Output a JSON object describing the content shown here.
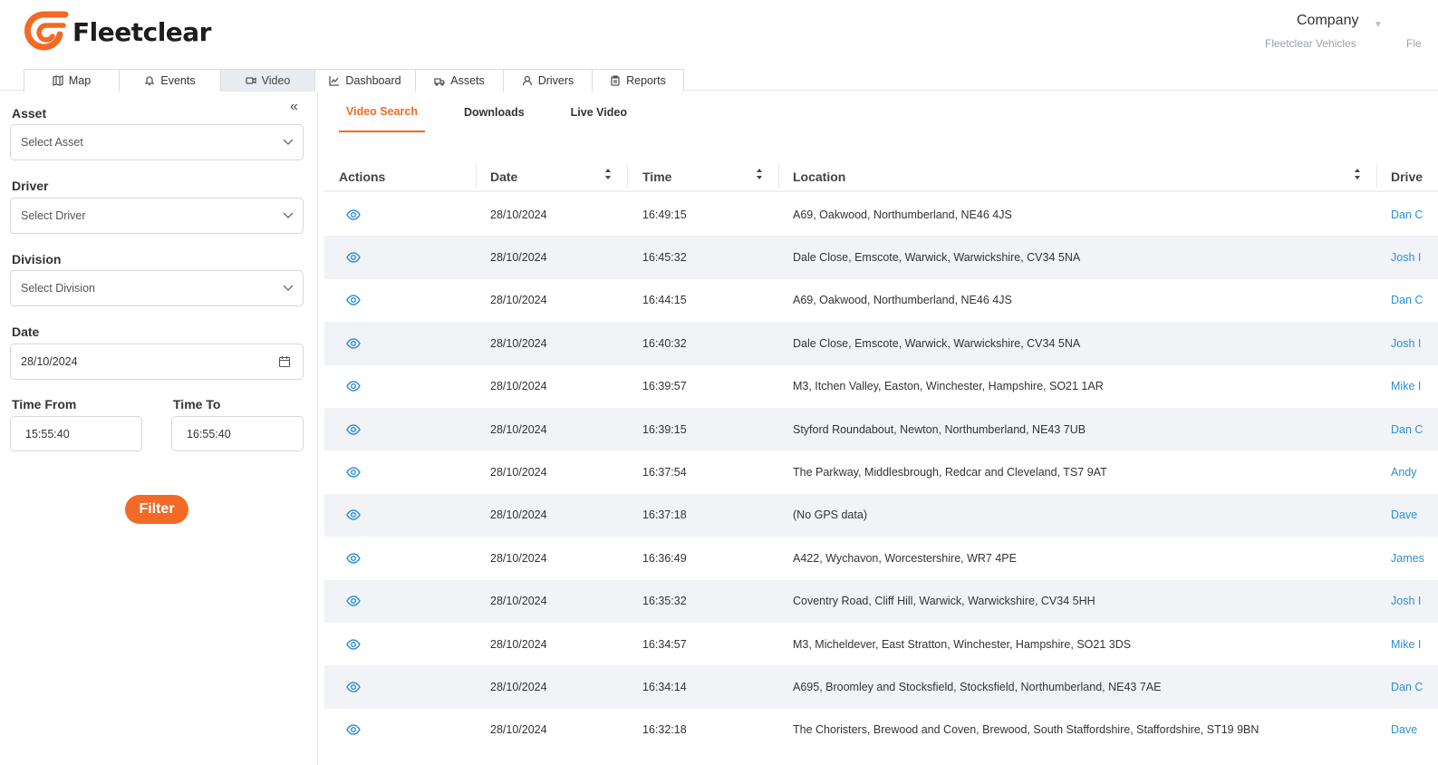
{
  "brand": {
    "name": "Fleetclear",
    "accent": "#f26a25",
    "link": "#2b8fd6"
  },
  "company": {
    "title": "Company",
    "subtitle": "Fleetclear Vehicles",
    "extra": "Fle"
  },
  "nav": {
    "tabs": [
      {
        "label": "Map",
        "icon": "map-icon"
      },
      {
        "label": "Events",
        "icon": "bell-icon"
      },
      {
        "label": "Video",
        "icon": "video-icon",
        "active": true
      },
      {
        "label": "Dashboard",
        "icon": "chart-icon"
      },
      {
        "label": "Assets",
        "icon": "truck-icon"
      },
      {
        "label": "Drivers",
        "icon": "user-icon"
      },
      {
        "label": "Reports",
        "icon": "clipboard-icon"
      }
    ]
  },
  "filters": {
    "asset_label": "Asset",
    "asset_placeholder": "Select Asset",
    "driver_label": "Driver",
    "driver_placeholder": "Select Driver",
    "division_label": "Division",
    "division_placeholder": "Select Division",
    "date_label": "Date",
    "date_value": "28/10/2024",
    "time_from_label": "Time From",
    "time_from_value": "15:55:40",
    "time_to_label": "Time To",
    "time_to_value": "16:55:40",
    "filter_button": "Filter"
  },
  "subtabs": [
    {
      "label": "Video Search",
      "active": true
    },
    {
      "label": "Downloads"
    },
    {
      "label": "Live Video"
    }
  ],
  "table": {
    "headers": {
      "actions": "Actions",
      "date": "Date",
      "time": "Time",
      "location": "Location",
      "driver": "Drive"
    },
    "rows": [
      {
        "date": "28/10/2024",
        "time": "16:49:15",
        "location": "A69, Oakwood, Northumberland, NE46 4JS",
        "driver": "Dan C"
      },
      {
        "date": "28/10/2024",
        "time": "16:45:32",
        "location": "Dale Close, Emscote, Warwick, Warwickshire, CV34 5NA",
        "driver": "Josh I"
      },
      {
        "date": "28/10/2024",
        "time": "16:44:15",
        "location": "A69, Oakwood, Northumberland, NE46 4JS",
        "driver": "Dan C"
      },
      {
        "date": "28/10/2024",
        "time": "16:40:32",
        "location": "Dale Close, Emscote, Warwick, Warwickshire, CV34 5NA",
        "driver": "Josh I"
      },
      {
        "date": "28/10/2024",
        "time": "16:39:57",
        "location": "M3, Itchen Valley, Easton, Winchester, Hampshire, SO21 1AR",
        "driver": "Mike I"
      },
      {
        "date": "28/10/2024",
        "time": "16:39:15",
        "location": "Styford Roundabout, Newton, Northumberland, NE43 7UB",
        "driver": "Dan C"
      },
      {
        "date": "28/10/2024",
        "time": "16:37:54",
        "location": "The Parkway, Middlesbrough, Redcar and Cleveland, TS7 9AT",
        "driver": "Andy"
      },
      {
        "date": "28/10/2024",
        "time": "16:37:18",
        "location": "(No GPS data)",
        "driver": "Dave"
      },
      {
        "date": "28/10/2024",
        "time": "16:36:49",
        "location": "A422, Wychavon, Worcestershire, WR7 4PE",
        "driver": "James"
      },
      {
        "date": "28/10/2024",
        "time": "16:35:32",
        "location": "Coventry Road, Cliff Hill, Warwick, Warwickshire, CV34 5HH",
        "driver": "Josh I"
      },
      {
        "date": "28/10/2024",
        "time": "16:34:57",
        "location": "M3, Micheldever, East Stratton, Winchester, Hampshire, SO21 3DS",
        "driver": "Mike I"
      },
      {
        "date": "28/10/2024",
        "time": "16:34:14",
        "location": "A695, Broomley and Stocksfield, Stocksfield, Northumberland, NE43 7AE",
        "driver": "Dan C"
      },
      {
        "date": "28/10/2024",
        "time": "16:32:18",
        "location": "The Choristers, Brewood and Coven, Brewood, South Staffordshire, Staffordshire, ST19 9BN",
        "driver": "Dave"
      }
    ]
  }
}
